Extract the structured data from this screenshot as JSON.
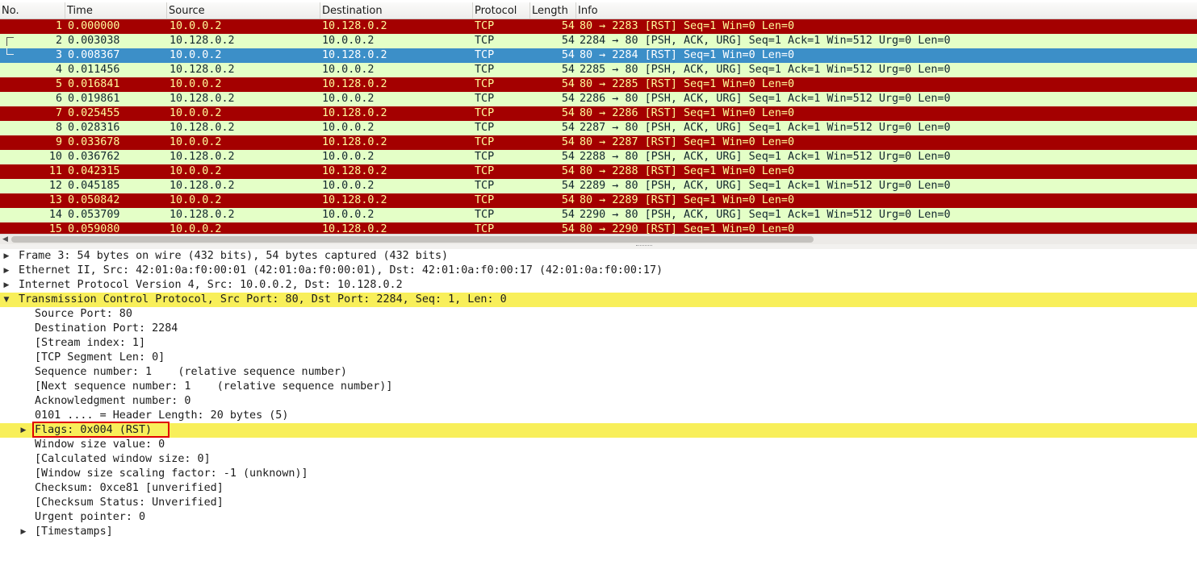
{
  "columns": {
    "no": "No.",
    "time": "Time",
    "source": "Source",
    "destination": "Destination",
    "protocol": "Protocol",
    "length": "Length",
    "info": "Info"
  },
  "colors": {
    "rst_bg": "#a40000",
    "rst_fg": "#fffc9c",
    "ok_bg": "#e7e6ff",
    "urg_bg": "#e4ffc7",
    "urg_fg": "#12272e",
    "selected_bg": "#3c8fc8",
    "selected_fg": "#ffffff",
    "highlight": "#f8ef5a",
    "flag_box": "#e00000"
  },
  "packets": [
    {
      "no": "1",
      "time": "0.000000",
      "src": "10.0.0.2",
      "dst": "10.128.0.2",
      "proto": "TCP",
      "len": "54",
      "info": "80 → 2283 [RST] Seq=1 Win=0 Len=0",
      "kind": "rst"
    },
    {
      "no": "2",
      "time": "0.003038",
      "src": "10.128.0.2",
      "dst": "10.0.0.2",
      "proto": "TCP",
      "len": "54",
      "info": "2284 → 80 [PSH, ACK, URG] Seq=1 Ack=1 Win=512 Urg=0 Len=0",
      "kind": "urg"
    },
    {
      "no": "3",
      "time": "0.008367",
      "src": "10.0.0.2",
      "dst": "10.128.0.2",
      "proto": "TCP",
      "len": "54",
      "info": "80 → 2284 [RST] Seq=1 Win=0 Len=0",
      "kind": "selected"
    },
    {
      "no": "4",
      "time": "0.011456",
      "src": "10.128.0.2",
      "dst": "10.0.0.2",
      "proto": "TCP",
      "len": "54",
      "info": "2285 → 80 [PSH, ACK, URG] Seq=1 Ack=1 Win=512 Urg=0 Len=0",
      "kind": "urg"
    },
    {
      "no": "5",
      "time": "0.016841",
      "src": "10.0.0.2",
      "dst": "10.128.0.2",
      "proto": "TCP",
      "len": "54",
      "info": "80 → 2285 [RST] Seq=1 Win=0 Len=0",
      "kind": "rst"
    },
    {
      "no": "6",
      "time": "0.019861",
      "src": "10.128.0.2",
      "dst": "10.0.0.2",
      "proto": "TCP",
      "len": "54",
      "info": "2286 → 80 [PSH, ACK, URG] Seq=1 Ack=1 Win=512 Urg=0 Len=0",
      "kind": "urg"
    },
    {
      "no": "7",
      "time": "0.025455",
      "src": "10.0.0.2",
      "dst": "10.128.0.2",
      "proto": "TCP",
      "len": "54",
      "info": "80 → 2286 [RST] Seq=1 Win=0 Len=0",
      "kind": "rst"
    },
    {
      "no": "8",
      "time": "0.028316",
      "src": "10.128.0.2",
      "dst": "10.0.0.2",
      "proto": "TCP",
      "len": "54",
      "info": "2287 → 80 [PSH, ACK, URG] Seq=1 Ack=1 Win=512 Urg=0 Len=0",
      "kind": "urg"
    },
    {
      "no": "9",
      "time": "0.033678",
      "src": "10.0.0.2",
      "dst": "10.128.0.2",
      "proto": "TCP",
      "len": "54",
      "info": "80 → 2287 [RST] Seq=1 Win=0 Len=0",
      "kind": "rst"
    },
    {
      "no": "10",
      "time": "0.036762",
      "src": "10.128.0.2",
      "dst": "10.0.0.2",
      "proto": "TCP",
      "len": "54",
      "info": "2288 → 80 [PSH, ACK, URG] Seq=1 Ack=1 Win=512 Urg=0 Len=0",
      "kind": "urg"
    },
    {
      "no": "11",
      "time": "0.042315",
      "src": "10.0.0.2",
      "dst": "10.128.0.2",
      "proto": "TCP",
      "len": "54",
      "info": "80 → 2288 [RST] Seq=1 Win=0 Len=0",
      "kind": "rst"
    },
    {
      "no": "12",
      "time": "0.045185",
      "src": "10.128.0.2",
      "dst": "10.0.0.2",
      "proto": "TCP",
      "len": "54",
      "info": "2289 → 80 [PSH, ACK, URG] Seq=1 Ack=1 Win=512 Urg=0 Len=0",
      "kind": "urg"
    },
    {
      "no": "13",
      "time": "0.050842",
      "src": "10.0.0.2",
      "dst": "10.128.0.2",
      "proto": "TCP",
      "len": "54",
      "info": "80 → 2289 [RST] Seq=1 Win=0 Len=0",
      "kind": "rst"
    },
    {
      "no": "14",
      "time": "0.053709",
      "src": "10.128.0.2",
      "dst": "10.0.0.2",
      "proto": "TCP",
      "len": "54",
      "info": "2290 → 80 [PSH, ACK, URG] Seq=1 Ack=1 Win=512 Urg=0 Len=0",
      "kind": "urg"
    },
    {
      "no": "15",
      "time": "0.059080",
      "src": "10.0.0.2",
      "dst": "10.128.0.2",
      "proto": "TCP",
      "len": "54",
      "info": "80 → 2290 [RST] Seq=1 Win=0 Len=0",
      "kind": "rst"
    }
  ],
  "details": [
    {
      "text": "Frame 3: 54 bytes on wire (432 bits), 54 bytes captured (432 bits)",
      "level": 0,
      "expander": "collapsed",
      "highlight": false
    },
    {
      "text": "Ethernet II, Src: 42:01:0a:f0:00:01 (42:01:0a:f0:00:01), Dst: 42:01:0a:f0:00:17 (42:01:0a:f0:00:17)",
      "level": 0,
      "expander": "collapsed",
      "highlight": false
    },
    {
      "text": "Internet Protocol Version 4, Src: 10.0.0.2, Dst: 10.128.0.2",
      "level": 0,
      "expander": "collapsed",
      "highlight": false
    },
    {
      "text": "Transmission Control Protocol, Src Port: 80, Dst Port: 2284, Seq: 1, Len: 0",
      "level": 0,
      "expander": "expanded",
      "highlight": true
    },
    {
      "text": "Source Port: 80",
      "level": 1,
      "expander": "none",
      "highlight": false
    },
    {
      "text": "Destination Port: 2284",
      "level": 1,
      "expander": "none",
      "highlight": false
    },
    {
      "text": "[Stream index: 1]",
      "level": 1,
      "expander": "none",
      "highlight": false
    },
    {
      "text": "[TCP Segment Len: 0]",
      "level": 1,
      "expander": "none",
      "highlight": false
    },
    {
      "text": "Sequence number: 1    (relative sequence number)",
      "level": 1,
      "expander": "none",
      "highlight": false
    },
    {
      "text": "[Next sequence number: 1    (relative sequence number)]",
      "level": 1,
      "expander": "none",
      "highlight": false
    },
    {
      "text": "Acknowledgment number: 0",
      "level": 1,
      "expander": "none",
      "highlight": false
    },
    {
      "text": "0101 .... = Header Length: 20 bytes (5)",
      "level": 1,
      "expander": "none",
      "highlight": false
    },
    {
      "text": "Flags: 0x004 (RST)",
      "level": 1,
      "expander": "collapsed",
      "highlight": true,
      "boxed": true
    },
    {
      "text": "Window size value: 0",
      "level": 1,
      "expander": "none",
      "highlight": false
    },
    {
      "text": "[Calculated window size: 0]",
      "level": 1,
      "expander": "none",
      "highlight": false
    },
    {
      "text": "[Window size scaling factor: -1 (unknown)]",
      "level": 1,
      "expander": "none",
      "highlight": false
    },
    {
      "text": "Checksum: 0xce81 [unverified]",
      "level": 1,
      "expander": "none",
      "highlight": false
    },
    {
      "text": "[Checksum Status: Unverified]",
      "level": 1,
      "expander": "none",
      "highlight": false
    },
    {
      "text": "Urgent pointer: 0",
      "level": 1,
      "expander": "none",
      "highlight": false
    },
    {
      "text": "[Timestamps]",
      "level": 1,
      "expander": "collapsed",
      "highlight": false
    }
  ]
}
